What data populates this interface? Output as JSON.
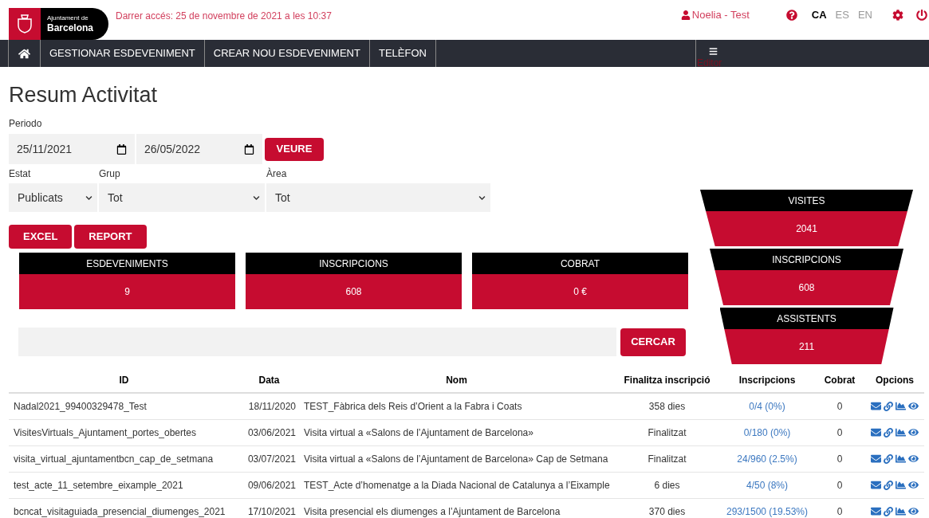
{
  "header": {
    "logo": {
      "line_1": "Ajuntament de",
      "line_2": "Barcelona"
    },
    "last_access": "Darrer accés: 25 de novembre de 2021 a les 10:37",
    "user": "Noelia - Test",
    "languages": [
      {
        "label": "CA",
        "selected": true
      },
      {
        "label": "ES",
        "selected": false
      },
      {
        "label": "EN",
        "selected": false
      }
    ]
  },
  "nav": {
    "items": [
      "GESTIONAR ESDEVENIMENT",
      "CREAR NOU ESDEVENIMENT",
      "TELÈFON"
    ],
    "role": "Editor"
  },
  "page_title": "Resum Activitat",
  "period": {
    "label": "Periodo",
    "from": "25/11/2021",
    "to": "26/05/2022",
    "button": "VEURE"
  },
  "filters": [
    {
      "label": "Estat",
      "value": "Publicats"
    },
    {
      "label": "Grup",
      "value": "Tot"
    },
    {
      "label": "Àrea",
      "value": "Tot"
    }
  ],
  "export_buttons": [
    "EXCEL",
    "REPORT"
  ],
  "stats": [
    {
      "label": "ESDEVENIMENTS",
      "value": "9"
    },
    {
      "label": "INSCRIPCIONS",
      "value": "608"
    },
    {
      "label": "COBRAT",
      "value": "0 €"
    }
  ],
  "funnel": [
    {
      "label": "VISITES",
      "value": "2041"
    },
    {
      "label": "INSCRIPCIONS",
      "value": "608"
    },
    {
      "label": "ASSISTENTS",
      "value": "211"
    }
  ],
  "search": {
    "button": "CERCAR"
  },
  "table": {
    "columns": [
      "ID",
      "Data",
      "Nom",
      "Finalitza inscripció",
      "Inscripcions",
      "Cobrat",
      "Opcions"
    ],
    "rows": [
      {
        "id": "Nadal2021_99400329478_Test",
        "date": "18/11/2020",
        "name": "TEST_Fàbrica dels Reis d’Orient a la Fabra i Coats",
        "ends": "358 dies",
        "registrations": "0/4 (0%)",
        "charged": "0"
      },
      {
        "id": "VisitesVirtuals_Ajuntament_portes_obertes",
        "date": "03/06/2021",
        "name": "Visita virtual a «Salons de l’Ajuntament de Barcelona»",
        "ends": "Finalitzat",
        "registrations": "0/180 (0%)",
        "charged": "0"
      },
      {
        "id": "visita_virtual_ajuntamentbcn_cap_de_setmana",
        "date": "03/07/2021",
        "name": "Visita virtual a «Salons de l’Ajuntament de Barcelona» Cap de Setmana",
        "ends": "Finalitzat",
        "registrations": "24/960 (2.5%)",
        "charged": "0"
      },
      {
        "id": "test_acte_11_setembre_eixample_2021",
        "date": "09/06/2021",
        "name": "TEST_Acte d’homenatge a la Diada Nacional de Catalunya a l’Eixample",
        "ends": "6 dies",
        "registrations": "4/50 (8%)",
        "charged": "0"
      },
      {
        "id": "bcncat_visitaguiada_presencial_diumenges_2021",
        "date": "17/10/2021",
        "name": "Visita presencial els diumenges a l’Ajuntament de Barcelona",
        "ends": "370 dies",
        "registrations": "293/1500 (19.53%)",
        "charged": "0"
      }
    ]
  }
}
